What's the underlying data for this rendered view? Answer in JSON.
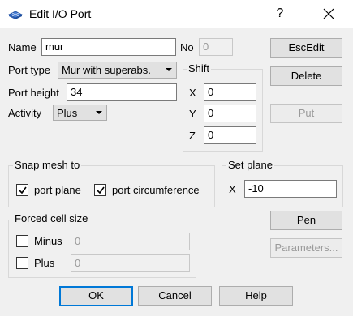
{
  "window": {
    "title": "Edit I/O Port",
    "help_label": "?",
    "icon": "port-app-icon",
    "close_icon": "close-icon"
  },
  "fields": {
    "name_label": "Name",
    "name_value": "mur",
    "no_label": "No",
    "no_value": "0",
    "port_type_label": "Port type",
    "port_type_value": "Mur with superabs.",
    "port_height_label": "Port height",
    "port_height_value": "34",
    "activity_label": "Activity",
    "activity_value": "Plus"
  },
  "shift": {
    "title": "Shift",
    "x_label": "X",
    "x_value": "0",
    "y_label": "Y",
    "y_value": "0",
    "z_label": "Z",
    "z_value": "0"
  },
  "snap": {
    "title": "Snap mesh to",
    "port_plane_label": "port plane",
    "port_plane_checked": true,
    "port_circ_label": "port circumference",
    "port_circ_checked": true
  },
  "set_plane": {
    "title": "Set plane",
    "x_label": "X",
    "x_value": "-10"
  },
  "forced": {
    "title": "Forced cell size",
    "minus_label": "Minus",
    "minus_value": "0",
    "plus_label": "Plus",
    "plus_value": "0"
  },
  "buttons": {
    "escedit": "EscEdit",
    "delete": "Delete",
    "put": "Put",
    "pen": "Pen",
    "parameters": "Parameters...",
    "ok": "OK",
    "cancel": "Cancel",
    "help": "Help"
  },
  "colors": {
    "accent": "#0078d7",
    "background": "#f0f0f0"
  }
}
